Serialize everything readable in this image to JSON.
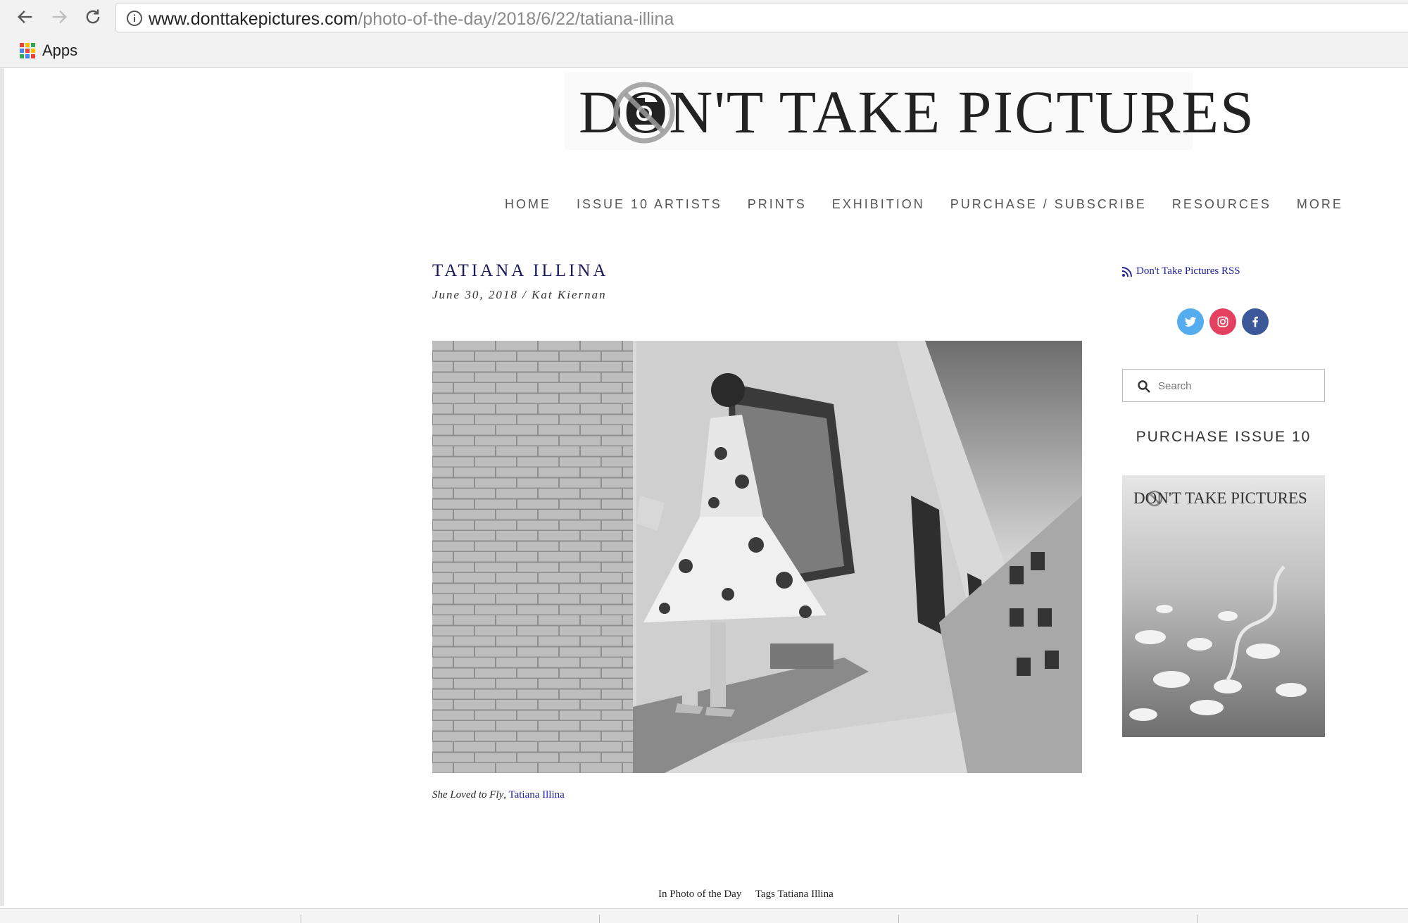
{
  "browser": {
    "url_domain": "www.donttakepictures.com",
    "url_path": "/photo-of-the-day/2018/6/22/tatiana-illina",
    "bookmarks": [
      {
        "label": "Apps",
        "icon": "apps-grid-icon"
      }
    ]
  },
  "site": {
    "logo_text": "DON'T TAKE PICTURES",
    "nav": [
      "HOME",
      "ISSUE 10 ARTISTS",
      "PRINTS",
      "EXHIBITION",
      "PURCHASE / SUBSCRIBE",
      "RESOURCES",
      "MORE"
    ]
  },
  "post": {
    "title": "TATIANA ILLINA",
    "date": "June 30, 2018",
    "author": "Kat Kiernan",
    "meta_separator": " / ",
    "caption_title": "She Loved to Fly",
    "caption_separator": ", ",
    "caption_artist": "Tatiana Illina",
    "category_label": "In Photo of the Day",
    "tags_label": "Tags Tatiana Illina"
  },
  "sidebar": {
    "rss_label": "Don't Take Pictures RSS",
    "social": [
      {
        "name": "twitter-icon",
        "color": "#55acee"
      },
      {
        "name": "instagram-icon",
        "color": "#e4405f"
      },
      {
        "name": "facebook-icon",
        "color": "#3b5998"
      }
    ],
    "search_placeholder": "Search",
    "purchase_heading": "PURCHASE ISSUE 10",
    "cover_title": "DON'T TAKE PICTURES"
  },
  "colors": {
    "title_navy": "#1a1a5e",
    "link_blue": "#22229a",
    "nav_gray": "#555555"
  }
}
